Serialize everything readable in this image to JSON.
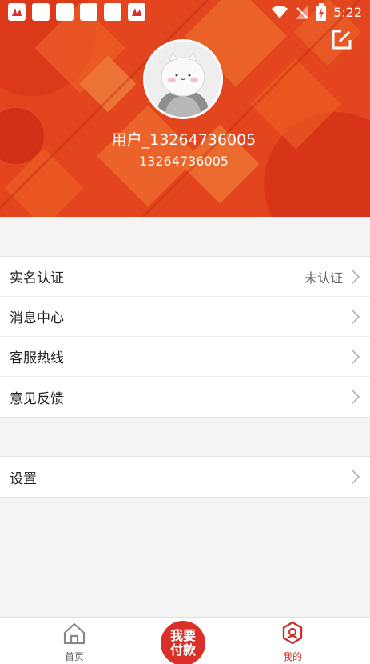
{
  "status_bar": {
    "time": "5:22",
    "icons": [
      "app-notification-icon",
      "square-icon",
      "square-icon",
      "square-icon",
      "square-icon",
      "app-notification-icon",
      "wifi-icon",
      "signal-off-icon",
      "battery-charging-icon"
    ]
  },
  "profile": {
    "username": "用户_13264736005",
    "phone": "13264736005"
  },
  "menu": {
    "group1": [
      {
        "label": "实名认证",
        "status": "未认证"
      },
      {
        "label": "消息中心",
        "status": ""
      },
      {
        "label": "客服热线",
        "status": ""
      },
      {
        "label": "意见反馈",
        "status": ""
      }
    ],
    "group2": [
      {
        "label": "设置",
        "status": ""
      }
    ]
  },
  "tabbar": {
    "home_label": "首页",
    "pay_line1": "我要",
    "pay_line2": "付款",
    "mine_label": "我的"
  },
  "colors": {
    "header_red": "#e2421e",
    "accent_red": "#c9302c",
    "background": "#f4f4f4"
  }
}
